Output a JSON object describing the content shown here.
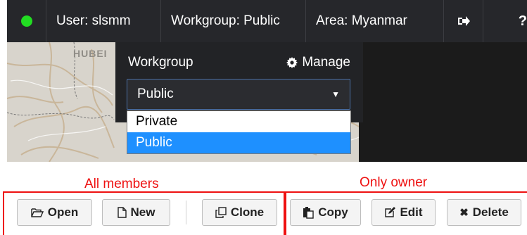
{
  "topbar": {
    "user_label": "User: slsmm",
    "workgroup_label": "Workgroup: Public",
    "area_label": "Area: Myanmar",
    "status_color": "#22dd22"
  },
  "map": {
    "place_label": "HUBEI"
  },
  "workgroup_panel": {
    "title": "Workgroup",
    "manage_label": "Manage",
    "selected_value": "Public",
    "options": [
      {
        "label": "Private",
        "selected": false
      },
      {
        "label": "Public",
        "selected": true
      }
    ]
  },
  "annotations": {
    "all_members": "All members",
    "only_owner": "Only owner",
    "color": "#ee1111"
  },
  "buttons": {
    "open": "Open",
    "new": "New",
    "clone": "Clone",
    "copy": "Copy",
    "edit": "Edit",
    "delete": "Delete"
  }
}
